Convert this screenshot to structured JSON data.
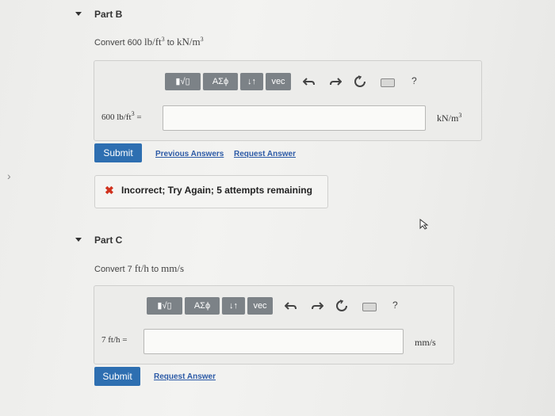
{
  "side_chevron": "›",
  "part_b": {
    "title": "Part B",
    "question_prefix": "Convert 600",
    "question_from_unit": "lb/ft",
    "question_from_exp": "3",
    "question_mid": "to",
    "question_to_unit": "kN/m",
    "question_to_exp": "3",
    "toolbar": {
      "templates_label": "▮√▯",
      "greek_label": "ΑΣϕ",
      "arrows_label": "↓↑",
      "vec_label": "vec",
      "undo_icon": "undo-icon",
      "redo_icon": "redo-icon",
      "reset_icon": "reset-icon",
      "keyboard_icon": "keyboard-icon",
      "help_label": "?"
    },
    "input_label_value": "600",
    "input_label_unit": "lb/ft",
    "input_label_exp": "3",
    "input_label_eq": "=",
    "input_value": "",
    "unit_label": "kN/m",
    "unit_exp": "3",
    "submit_label": "Submit",
    "previous_answers_label": "Previous Answers",
    "request_answer_label": "Request Answer",
    "feedback": {
      "icon": "✖",
      "text": "Incorrect; Try Again; 5 attempts remaining",
      "status_color": "#d0321e"
    }
  },
  "part_c": {
    "title": "Part C",
    "question_prefix": "Convert 7",
    "question_from_unit": "ft/h",
    "question_mid": "to",
    "question_to_unit": "mm/s",
    "toolbar": {
      "templates_label": "▮√▯",
      "greek_label": "ΑΣϕ",
      "arrows_label": "↓↑",
      "vec_label": "vec",
      "help_label": "?"
    },
    "input_label": "7 ft/h",
    "input_label_eq": "=",
    "input_value": "",
    "unit_label": "mm/s",
    "submit_label": "Submit",
    "request_answer_label": "Request Answer"
  },
  "colors": {
    "submit_bg": "#2e6fb1",
    "link": "#2c5aa6",
    "toolbar_btn": "#7c8287"
  }
}
